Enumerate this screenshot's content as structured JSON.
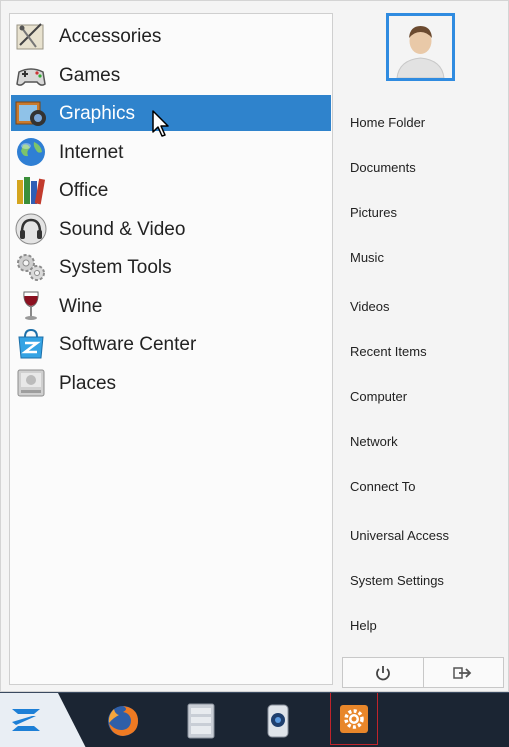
{
  "categories": [
    {
      "label": "Accessories",
      "icon": "accessories-icon"
    },
    {
      "label": "Games",
      "icon": "gamepad-icon"
    },
    {
      "label": "Graphics",
      "icon": "graphics-icon",
      "selected": true
    },
    {
      "label": "Internet",
      "icon": "globe-icon"
    },
    {
      "label": "Office",
      "icon": "books-icon"
    },
    {
      "label": "Sound & Video",
      "icon": "headphones-icon"
    },
    {
      "label": "System Tools",
      "icon": "gears-icon"
    },
    {
      "label": "Wine",
      "icon": "wine-glass-icon"
    },
    {
      "label": "Software Center",
      "icon": "software-center-icon"
    },
    {
      "label": "Places",
      "icon": "drive-icon"
    }
  ],
  "places": [
    {
      "label": "Home Folder"
    },
    {
      "label": "Documents"
    },
    {
      "label": "Pictures"
    },
    {
      "label": "Music"
    },
    {
      "label": "Videos"
    },
    {
      "label": "Recent Items"
    },
    {
      "label": "Computer"
    },
    {
      "label": "Network"
    },
    {
      "label": "Connect To"
    },
    {
      "label": "Universal Access"
    },
    {
      "label": "System Settings"
    },
    {
      "label": "Help"
    }
  ],
  "colors": {
    "accent": "#2f83cc",
    "taskbar": "#1b2533",
    "active_task_outline": "#c0242b"
  },
  "taskbar_items": [
    {
      "icon": "zorin-logo-icon"
    },
    {
      "icon": "firefox-icon"
    },
    {
      "icon": "file-manager-icon"
    },
    {
      "icon": "camera-icon"
    },
    {
      "icon": "settings-gear-icon",
      "active": true
    }
  ]
}
